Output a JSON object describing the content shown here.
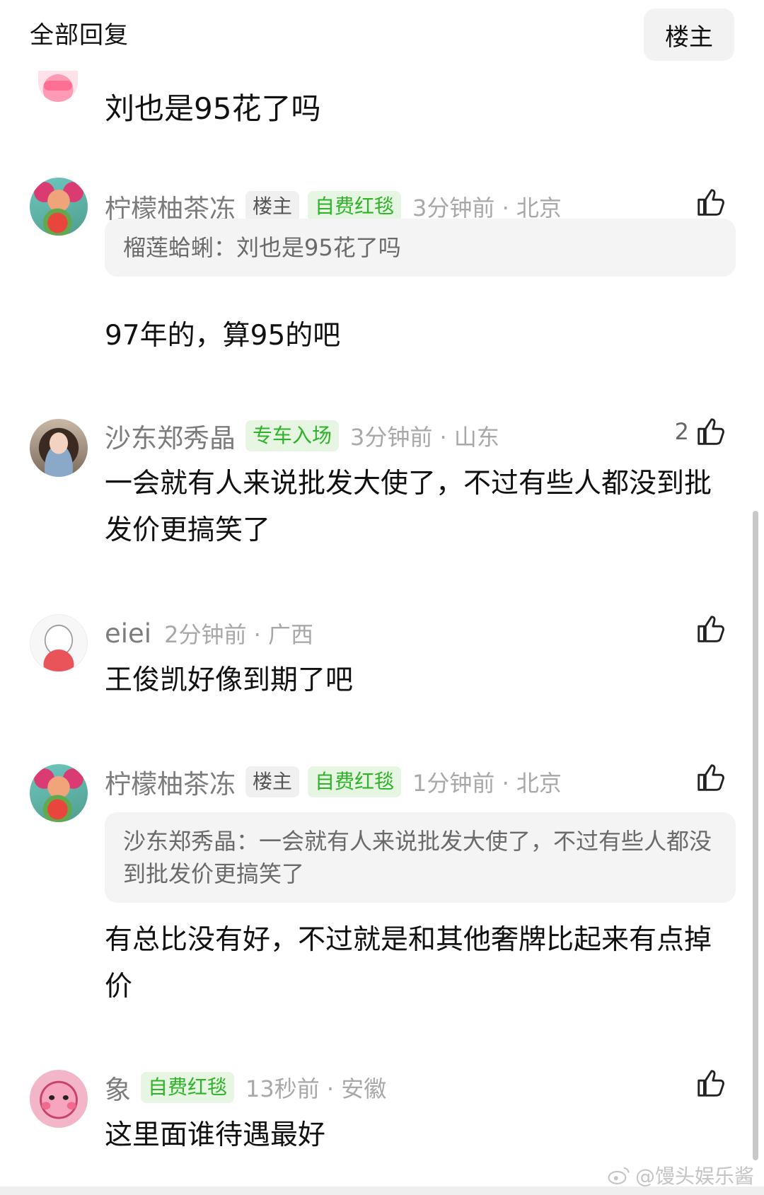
{
  "header": {
    "title": "全部回复",
    "filter_label": "楼主"
  },
  "partial_reply": {
    "text": "刘也是95花了吗"
  },
  "comments": [
    {
      "username": "柠檬柚茶冻",
      "tags": [
        "楼主",
        "自费红毯"
      ],
      "time_location": "3分钟前 · 北京",
      "likes": "",
      "quote": "榴莲蛤蜊：刘也是95花了吗",
      "text": "97年的，算95的吧"
    },
    {
      "username": "沙东郑秀晶",
      "tags": [
        "专车入场"
      ],
      "time_location": "3分钟前 · 山东",
      "likes": "2",
      "quote": "",
      "text": "一会就有人来说批发大使了，不过有些人都没到批发价更搞笑了"
    },
    {
      "username": "eiei",
      "tags": [],
      "time_location": "2分钟前 · 广西",
      "likes": "",
      "quote": "",
      "text": "王俊凯好像到期了吧"
    },
    {
      "username": "柠檬柚茶冻",
      "tags": [
        "楼主",
        "自费红毯"
      ],
      "time_location": "1分钟前 · 北京",
      "likes": "",
      "quote": "沙东郑秀晶：一会就有人来说批发大使了，不过有些人都没到批发价更搞笑了",
      "text": "有总比没有好，不过就是和其他奢牌比起来有点掉价"
    },
    {
      "username": "象",
      "tags": [
        "自费红毯"
      ],
      "time_location": "13秒前 · 安徽",
      "likes": "",
      "quote": "",
      "text": "这里面谁待遇最好"
    }
  ],
  "watermark": "@馒头娱乐酱",
  "icons": {
    "like": "thumbs-up-icon",
    "weibo": "weibo-logo-icon"
  },
  "colors": {
    "tag_green_bg": "#e6f6e3",
    "tag_green_text": "#2fb22a",
    "meta_gray": "#a8a8a8"
  }
}
